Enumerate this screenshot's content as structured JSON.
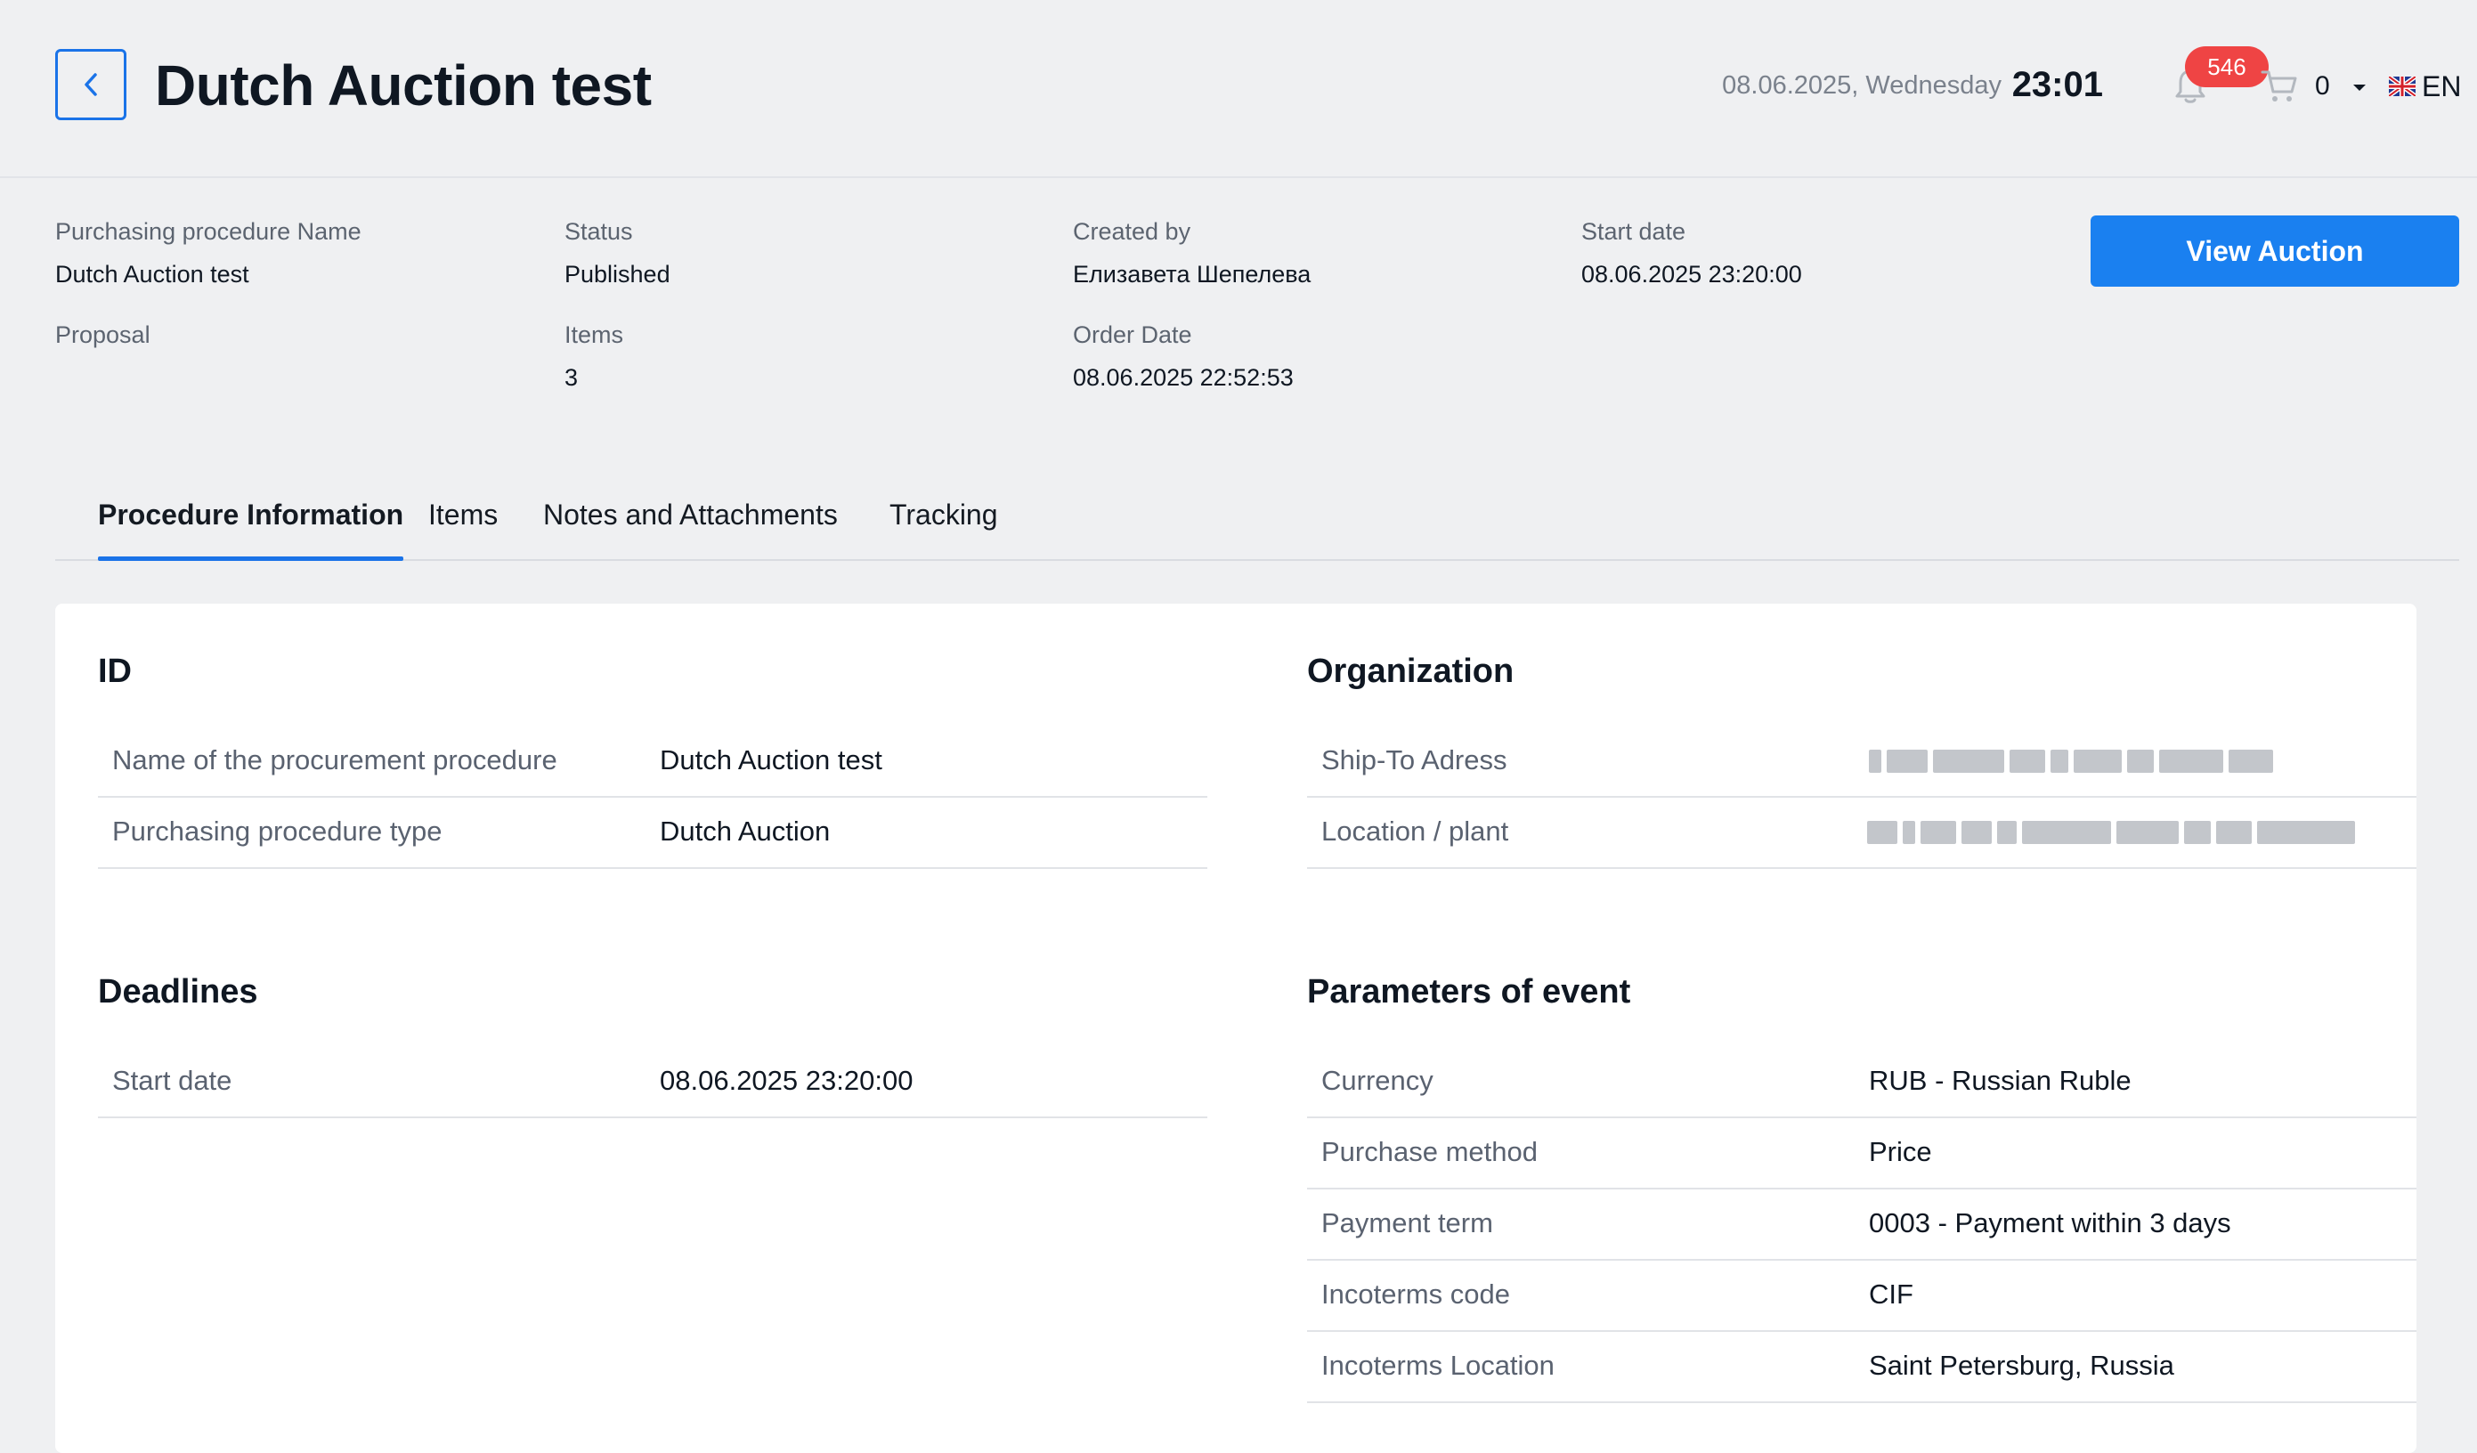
{
  "header": {
    "title": "Dutch Auction test",
    "date": "08.06.2025, Wednesday",
    "time": "23:01",
    "notifications_count": "546",
    "cart_count": "0",
    "language": "EN",
    "icons": [
      "chevron-left-icon",
      "bell-icon",
      "cart-icon",
      "caret-down-icon",
      "uk-flag-icon"
    ]
  },
  "summary": {
    "name_label": "Purchasing procedure Name",
    "name_value": "Dutch Auction test",
    "status_label": "Status",
    "status_value": "Published",
    "created_by_label": "Created by",
    "created_by_value": "Елизавета Шепелева",
    "start_date_label": "Start date",
    "start_date_value": "08.06.2025 23:20:00",
    "proposal_label": "Proposal",
    "items_label": "Items",
    "items_value": "3",
    "order_date_label": "Order Date",
    "order_date_value": "08.06.2025 22:52:53",
    "view_auction_label": "View Auction"
  },
  "tabs": [
    {
      "label": "Procedure Information",
      "active": true
    },
    {
      "label": "Items",
      "active": false
    },
    {
      "label": "Notes and Attachments",
      "active": false
    },
    {
      "label": "Tracking",
      "active": false
    }
  ],
  "sections": {
    "id": {
      "title": "ID",
      "rows": [
        {
          "label": "Name of the procurement procedure",
          "value": "Dutch Auction test"
        },
        {
          "label": "Purchasing procedure type",
          "value": "Dutch Auction"
        }
      ]
    },
    "organization": {
      "title": "Organization",
      "rows": [
        {
          "label": "Ship-To Adress",
          "value": ""
        },
        {
          "label": "Location / plant",
          "value": ""
        }
      ]
    },
    "deadlines": {
      "title": "Deadlines",
      "rows": [
        {
          "label": "Start date",
          "value": "08.06.2025 23:20:00"
        }
      ]
    },
    "parameters": {
      "title": "Parameters of event",
      "rows": [
        {
          "label": "Currency",
          "value": "RUB - Russian Ruble"
        },
        {
          "label": "Purchase method",
          "value": "Price"
        },
        {
          "label": "Payment term",
          "value": "0003 - Payment within 3 days"
        },
        {
          "label": "Incoterms code",
          "value": "CIF"
        },
        {
          "label": "Incoterms Location",
          "value": "Saint Petersburg, Russia"
        }
      ]
    }
  },
  "colors": {
    "accent": "#1a73e8",
    "button": "#1a80f0",
    "badge": "#ef4444",
    "background": "#eff0f2"
  }
}
